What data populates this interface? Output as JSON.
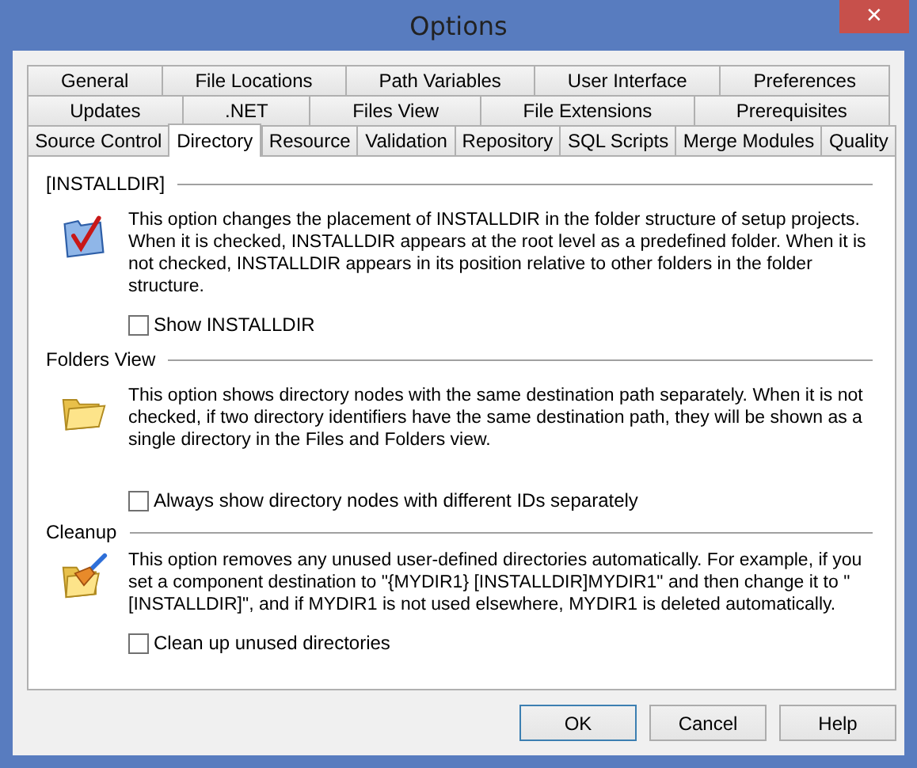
{
  "window": {
    "title": "Options",
    "close_glyph": "✕"
  },
  "tab_rows": [
    [
      {
        "label": "General",
        "selected": false
      },
      {
        "label": "File Locations",
        "selected": false
      },
      {
        "label": "Path Variables",
        "selected": false
      },
      {
        "label": "User Interface",
        "selected": false
      },
      {
        "label": "Preferences",
        "selected": false
      }
    ],
    [
      {
        "label": "Updates",
        "selected": false
      },
      {
        "label": ".NET",
        "selected": false
      },
      {
        "label": "Files View",
        "selected": false
      },
      {
        "label": "File Extensions",
        "selected": false
      },
      {
        "label": "Prerequisites",
        "selected": false
      }
    ],
    [
      {
        "label": "Source Control",
        "selected": false
      },
      {
        "label": "Directory",
        "selected": true
      },
      {
        "label": "Resource",
        "selected": false
      },
      {
        "label": "Validation",
        "selected": false
      },
      {
        "label": "Repository",
        "selected": false
      },
      {
        "label": "SQL Scripts",
        "selected": false
      },
      {
        "label": "Merge Modules",
        "selected": false
      },
      {
        "label": "Quality",
        "selected": false
      }
    ]
  ],
  "sections": [
    {
      "title": "[INSTALLDIR]",
      "description": "This option changes the placement of INSTALLDIR in the folder structure of setup projects. When it is checked, INSTALLDIR appears at the root level as a predefined folder. When it is not checked, INSTALLDIR appears in its position relative to other folders in the folder structure.",
      "checkbox": {
        "label": "Show INSTALLDIR",
        "checked": false
      }
    },
    {
      "title": "Folders View",
      "description": "This option shows directory nodes with the same destination path separately. When it is not checked, if two directory identifiers have the same destination path, they will be shown as a single directory in the Files and Folders view.",
      "checkbox": {
        "label": "Always show directory nodes with different IDs separately",
        "checked": false
      }
    },
    {
      "title": "Cleanup",
      "description": "This option removes any unused user-defined directories automatically. For example, if you set a component destination to \"{MYDIR1} [INSTALLDIR]MYDIR1\" and then change it to \"[INSTALLDIR]\", and if MYDIR1 is not used elsewhere, MYDIR1 is deleted automatically.",
      "checkbox": {
        "label": "Clean up unused directories",
        "checked": false
      }
    }
  ],
  "buttons": [
    {
      "label": "OK",
      "default": true
    },
    {
      "label": "Cancel",
      "default": false
    },
    {
      "label": "Help",
      "default": false
    }
  ]
}
